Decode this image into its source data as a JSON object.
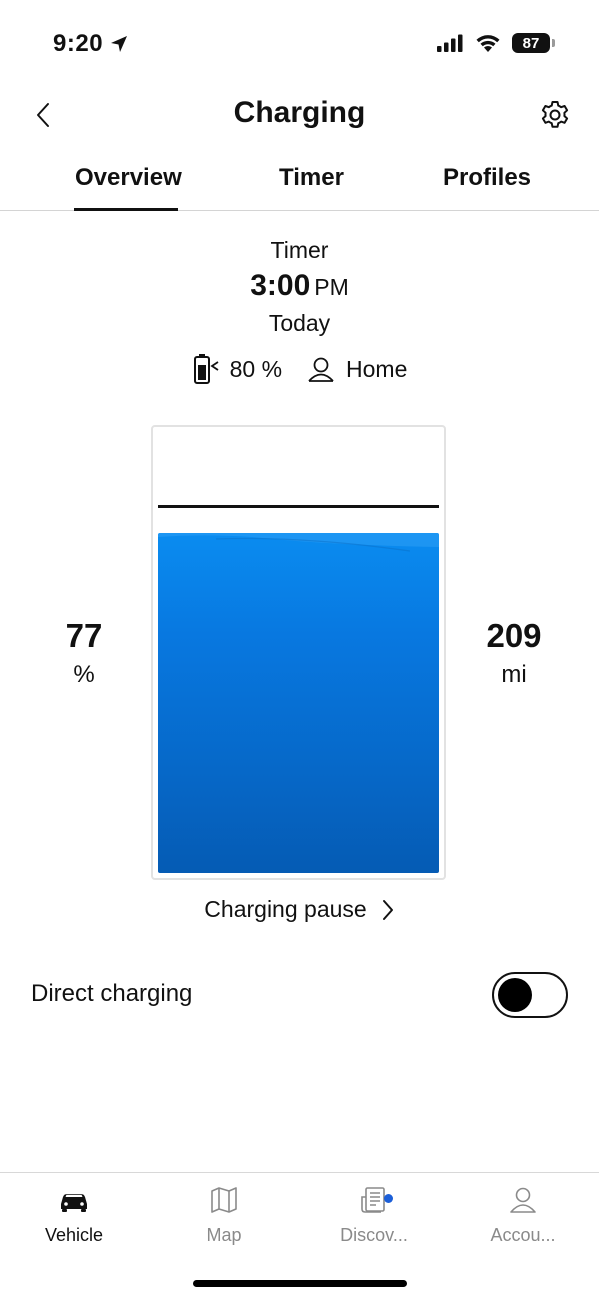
{
  "status_bar": {
    "time": "9:20",
    "battery_level": "87"
  },
  "header": {
    "title": "Charging"
  },
  "tabs": [
    {
      "label": "Overview",
      "active": true
    },
    {
      "label": "Timer",
      "active": false
    },
    {
      "label": "Profiles",
      "active": false
    }
  ],
  "timer": {
    "label": "Timer",
    "time": "3:00",
    "ampm": "PM",
    "day": "Today",
    "target_charge": "80 %",
    "profile": "Home"
  },
  "gauge": {
    "state_of_charge": "77",
    "soc_unit": "%",
    "range": "209",
    "range_unit": "mi",
    "fill_fraction": 0.77,
    "limit_fraction": 0.8,
    "fill_color": "#0878e0"
  },
  "charging_pause": {
    "label": "Charging pause"
  },
  "direct_charging": {
    "label": "Direct charging",
    "enabled": false
  },
  "bottom_nav": [
    {
      "label": "Vehicle",
      "icon": "car-icon",
      "active": true
    },
    {
      "label": "Map",
      "icon": "map-icon",
      "active": false
    },
    {
      "label": "Discov...",
      "icon": "news-icon",
      "active": false,
      "has_notification": true
    },
    {
      "label": "Accou...",
      "icon": "person-icon",
      "active": false
    }
  ]
}
